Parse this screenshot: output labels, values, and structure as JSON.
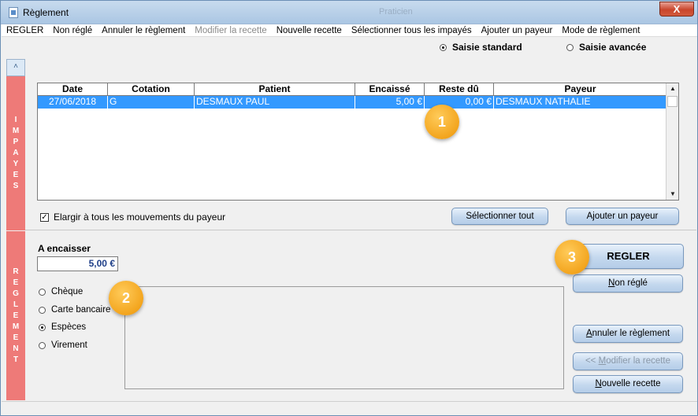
{
  "window": {
    "title": "Règlement",
    "ghost_title": "Praticien",
    "close_label": "X"
  },
  "menu": [
    {
      "label": "REGLER",
      "disabled": false
    },
    {
      "label": "Non réglé",
      "disabled": false
    },
    {
      "label": "Annuler le règlement",
      "disabled": false
    },
    {
      "label": "Modifier la recette",
      "disabled": true
    },
    {
      "label": "Nouvelle recette",
      "disabled": false
    },
    {
      "label": "Sélectionner tous les impayés",
      "disabled": false
    },
    {
      "label": "Ajouter un payeur",
      "disabled": false
    },
    {
      "label": "Mode de règlement",
      "disabled": false
    }
  ],
  "mode": {
    "standard": "Saisie standard",
    "advanced": "Saisie avancée",
    "selected": "standard"
  },
  "sidebars": {
    "impayes": [
      "I",
      "M",
      "P",
      "A",
      "Y",
      "E",
      "S"
    ],
    "reglement": [
      "R",
      "E",
      "G",
      "L",
      "E",
      "M",
      "E",
      "N",
      "T"
    ]
  },
  "grid": {
    "columns": [
      "Date",
      "Cotation",
      "Patient",
      "Encaissé",
      "Reste dû",
      "Payeur"
    ],
    "rows": [
      {
        "date": "27/06/2018",
        "cotation": "G",
        "patient": "DESMAUX PAUL",
        "encaisse": "5,00 €",
        "reste": "0,00 €",
        "payeur": "DESMAUX NATHALIE"
      }
    ]
  },
  "impayes": {
    "checkbox_label": "Elargir à tous les mouvements du payeur",
    "checkbox_checked": "✓",
    "select_all_button": "Sélectionner tout",
    "add_payer_button": "Ajouter un payeur"
  },
  "reglement": {
    "amount_label": "A encaisser",
    "amount_value": "5,00 €",
    "methods": [
      {
        "label": "Chèque",
        "checked": false
      },
      {
        "label": "Carte bancaire",
        "checked": false
      },
      {
        "label": "Espèces",
        "checked": true
      },
      {
        "label": "Virement",
        "checked": false
      }
    ],
    "buttons": {
      "regler": "REGLER",
      "non_regle_a": "N",
      "non_regle_b": "on réglé",
      "annuler_a": "A",
      "annuler_b": "nnuler le règlement",
      "modifier_a": "<< ",
      "modifier_b": "M",
      "modifier_c": "odifier la recette",
      "nouvelle_a": "N",
      "nouvelle_b": "ouvelle recette"
    }
  },
  "callouts": [
    "1",
    "2",
    "3"
  ],
  "colors": {
    "accent_side": "#ee7a78",
    "selection": "#3399ff",
    "callout": "#f3a51e"
  }
}
